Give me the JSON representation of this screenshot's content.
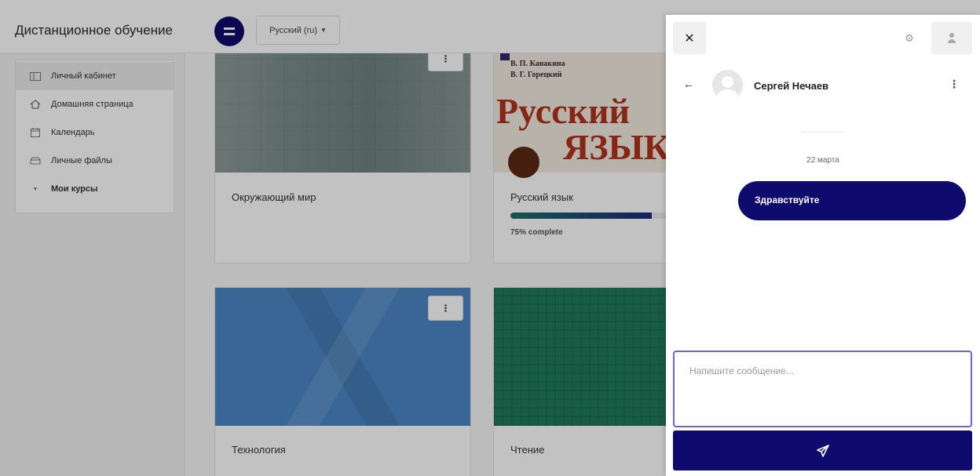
{
  "navbar": {
    "brand": "Дистанционное обучение",
    "language": "Русский (ru)"
  },
  "sidebar": {
    "items": [
      {
        "label": "Личный кабинет",
        "icon": "dashboard-icon"
      },
      {
        "label": "Домашняя страница",
        "icon": "home-icon"
      },
      {
        "label": "Календарь",
        "icon": "calendar-icon"
      },
      {
        "label": "Личные файлы",
        "icon": "files-icon"
      },
      {
        "label": "Мои курсы",
        "icon": "caret-down-icon"
      }
    ]
  },
  "courses": [
    {
      "title": "Окружающий мир"
    },
    {
      "title": "Русский язык",
      "progress": 75,
      "progress_label": "75% complete",
      "cover_authors": [
        "В. П. Канакина",
        "В. Г. Горецкий"
      ],
      "cover_title_1": "Русский",
      "cover_title_2": "язык"
    },
    {
      "title": "Технология"
    },
    {
      "title": "Чтение"
    }
  ],
  "drawer": {
    "contact_name": "Сергей Нечаев",
    "date": "22 марта",
    "messages": [
      {
        "text": "Здравствуйте"
      }
    ],
    "input_placeholder": "Напишите сообщение...",
    "colors": {
      "accent": "#0f0a6e",
      "focus_border": "#6f63d6"
    }
  }
}
